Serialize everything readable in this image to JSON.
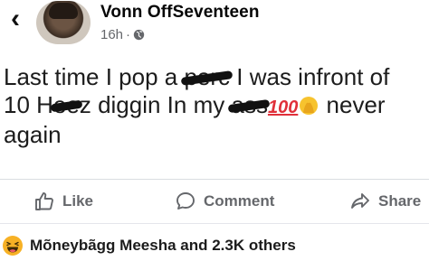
{
  "header": {
    "author": "Vonn OffSeventeen",
    "time": "16h",
    "separator": "·",
    "icons": [
      "back-arrow-icon",
      "globe-icon"
    ]
  },
  "post": {
    "line1_pre": "Last time I pop a ",
    "line1_redacted": "perc",
    "line1_post": " I was infront of",
    "line2_pre": "10 H",
    "line2_redacted": "ee",
    "line2_mid": "z diggin In my ",
    "line2_redacted2": "ass",
    "emoji_100": "100",
    "line2_post": " never",
    "line3": "again"
  },
  "actions": {
    "like": "Like",
    "comment": "Comment",
    "share": "Share"
  },
  "reactions": {
    "text": "Mõneybãgg Meesha and 2.3K others",
    "icon": "haha-reaction-icon"
  },
  "colors": {
    "text": "#050505",
    "muted": "#65676b",
    "divider": "#dadde1",
    "reaction_yellow": "#f7b125",
    "emoji_red": "#e0303a"
  }
}
